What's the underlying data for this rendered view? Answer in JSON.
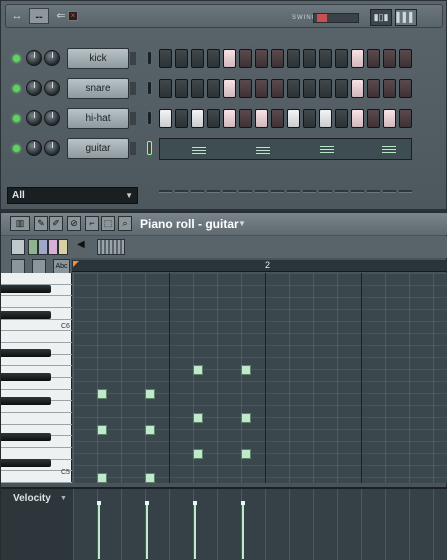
{
  "sequencer": {
    "swing_label": "SWING",
    "swing_level": 0.12,
    "filter_value": "All",
    "channels": [
      {
        "name": "kick",
        "steps": [
          0,
          0,
          0,
          0,
          1,
          0,
          0,
          0,
          0,
          0,
          0,
          0,
          1,
          0,
          0,
          0
        ]
      },
      {
        "name": "snare",
        "steps": [
          0,
          0,
          0,
          0,
          1,
          0,
          0,
          0,
          0,
          0,
          0,
          0,
          1,
          0,
          0,
          0
        ]
      },
      {
        "name": "hi-hat",
        "steps": [
          1,
          0,
          1,
          0,
          1,
          0,
          1,
          0,
          1,
          0,
          1,
          0,
          1,
          0,
          1,
          0
        ]
      },
      {
        "name": "guitar",
        "steps": null
      }
    ]
  },
  "piano_roll": {
    "title": "Piano roll - guitar",
    "ruler_bar": "2",
    "key_labels": {
      "c6": "C6",
      "c5": "C5"
    },
    "velocity_label": "Velocity",
    "notes_count_columns": 4
  },
  "icons": {
    "arrows": "↔",
    "back": "⇐",
    "close": "×"
  }
}
